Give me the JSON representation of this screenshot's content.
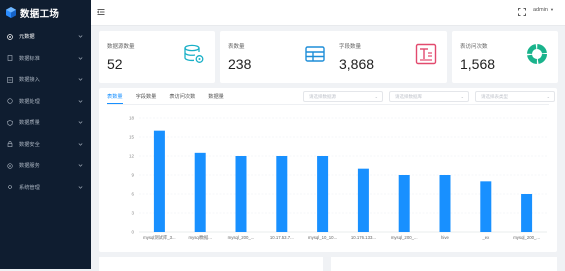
{
  "app": {
    "title": "数据工场"
  },
  "sidebar": {
    "items": [
      {
        "label": "元数据",
        "icon": "target-icon",
        "active": true
      },
      {
        "label": "数据标准",
        "icon": "document-icon",
        "active": false
      },
      {
        "label": "数据接入",
        "icon": "import-icon",
        "active": false
      },
      {
        "label": "数据处理",
        "icon": "process-icon",
        "active": false
      },
      {
        "label": "数据质量",
        "icon": "quality-icon",
        "active": false
      },
      {
        "label": "数据安全",
        "icon": "lock-icon",
        "active": false
      },
      {
        "label": "数据服务",
        "icon": "service-icon",
        "active": false
      },
      {
        "label": "系统管理",
        "icon": "settings-icon",
        "active": false
      }
    ]
  },
  "topbar": {
    "collapse_icon": "menu-fold-icon",
    "fullscreen_icon": "fullscreen-icon",
    "user": "admin"
  },
  "stats": [
    {
      "label": "数据源数量",
      "value": "52",
      "icon": "database-gear-icon",
      "color": "#1ab0c7"
    },
    {
      "label": "表数量",
      "value": "238",
      "icon": "table-icon",
      "color": "#1e8ed8"
    },
    {
      "label": "字段数量",
      "value": "3,868",
      "icon": "field-text-icon",
      "color": "#e24a6e"
    },
    {
      "label": "表访问次数",
      "value": "1,568",
      "icon": "pie-ring-icon",
      "color": "#1ab38c"
    }
  ],
  "panel": {
    "tabs": [
      "表数量",
      "字段数量",
      "表访问次数",
      "数据量"
    ],
    "active_tab": 0,
    "selects": [
      "请选择数据源",
      "请选择数据库",
      "请选择表类型"
    ]
  },
  "chart_data": {
    "type": "bar",
    "categories": [
      "mysql测试库_3...",
      "mysql数据...",
      "mysql_200_...",
      "10.17.53.7...",
      "mysql_10_10...",
      "10.176.133...",
      "mysql_200_...",
      "hive",
      "_ex",
      "mysql_200_..."
    ],
    "values": [
      16,
      12.5,
      12,
      12,
      12,
      10,
      9,
      9,
      8,
      6
    ],
    "yticks": [
      0,
      3,
      6,
      9,
      12,
      15,
      18
    ],
    "ylim": [
      0,
      18
    ],
    "color": "#1890ff",
    "grid": true
  }
}
